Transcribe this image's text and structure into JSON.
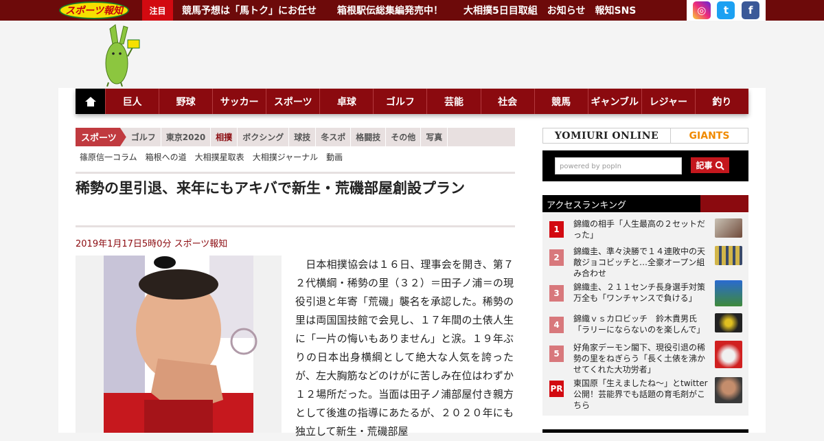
{
  "topbar": {
    "logo_text": "スポーツ報知",
    "attention_label": "注目",
    "links": [
      "競馬予想は「馬トク」にお任せ",
      "箱根駅伝総集編発売中！",
      "大相撲5日目取組",
      "お知らせ",
      "報知SNS"
    ],
    "social": [
      "instagram-icon",
      "twitter-icon",
      "facebook-icon"
    ]
  },
  "mainnav": {
    "items": [
      "巨人",
      "野球",
      "サッカー",
      "スポーツ",
      "卓球",
      "ゴルフ",
      "芸能",
      "社会",
      "競馬",
      "ギャンブル",
      "レジャー",
      "釣り"
    ]
  },
  "subnav": {
    "active": "スポーツ",
    "items": [
      "ゴルフ",
      "東京2020",
      "相撲",
      "ボクシング",
      "球技",
      "冬スポ",
      "格闘技",
      "その他",
      "写真"
    ],
    "selected": "相撲"
  },
  "tags": [
    "篠原信一コラム",
    "箱根への道",
    "大相撲星取表",
    "大相撲ジャーナル",
    "動画"
  ],
  "article": {
    "headline": "稀勢の里引退、来年にもアキバで新生・荒磯部屋創設プラン",
    "dateline": "2019年1月17日5時0分  スポーツ報知",
    "body": "　日本相撲協会は１６日、理事会を開き、第７２代横綱・稀勢の里（３２）＝田子ノ浦＝の現役引退と年寄「荒磯」襲名を承認した。稀勢の里は両国国技館で会見し、１７年間の土俵人生に「一片の悔いもありません」と涙。１９年ぶりの日本出身横綱として絶大な人気を誇ったが、左大胸筋などのけがに苦しみ在位はわずか１２場所だった。当面は田子ノ浦部屋付き親方として後進の指導にあたるが、２０２０年にも独立して新生・荒磯部屋"
  },
  "sidebar": {
    "banner_left": "YOMIURI ONLINE",
    "banner_right": "GIANTS",
    "search_placeholder": "powered by popIn",
    "search_button": "記事",
    "ranking_title": "アクセスランキング",
    "ranking": [
      {
        "rank": "1",
        "text": "錦織の相手「人生最高の２セットだった」"
      },
      {
        "rank": "2",
        "text": "錦織圭、準々決勝で１４連敗中の天敵ジョコビッチと…全豪オープン組み合わせ"
      },
      {
        "rank": "3",
        "text": "錦織圭、２１１センチ長身選手対策万全も「ワンチャンスで負ける」"
      },
      {
        "rank": "4",
        "text": "錦織ｖｓカロビッチ　鈴木貴男氏「ラリーにならないのを楽しんで」"
      },
      {
        "rank": "5",
        "text": "好角家デーモン閣下、現役引退の稀勢の里をねぎらう「長く土俵を沸かせてくれた大功労者」"
      },
      {
        "rank": "PR",
        "text": "東国原「生えましたね～」とtwitter公開！芸能界でも話題の育毛剤がこちら"
      }
    ]
  },
  "colors": {
    "brand_dark": "#6d0a0a",
    "nav_red": "#8b0a0f",
    "rank1": "#d20a11",
    "rank_other": "#d8787c"
  }
}
